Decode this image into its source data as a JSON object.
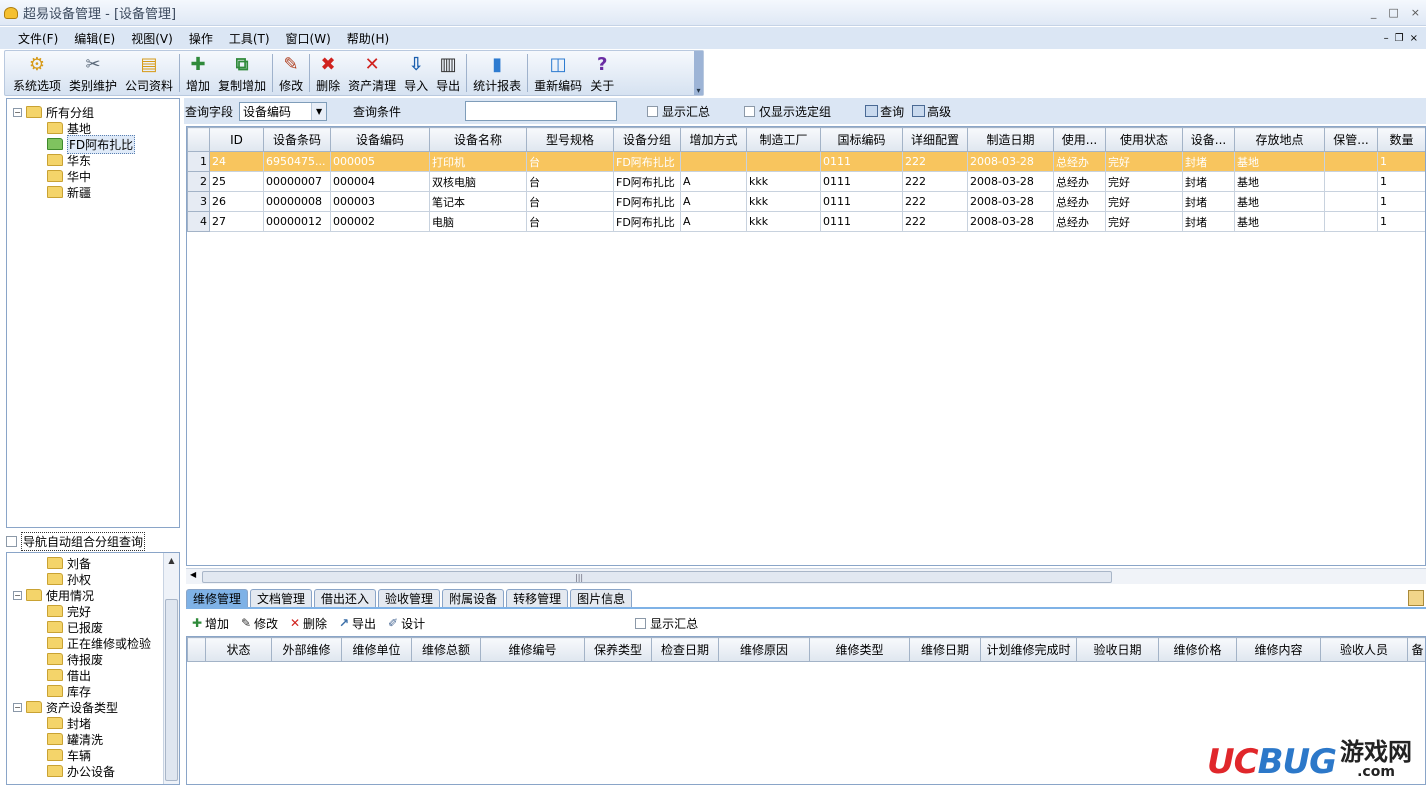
{
  "window": {
    "title": "超易设备管理 - [设备管理]",
    "minimize": "_",
    "maximize": "□",
    "close": "×"
  },
  "menu": [
    "文件(F)",
    "编辑(E)",
    "视图(V)",
    "操作",
    "工具(T)",
    "窗口(W)",
    "帮助(H)"
  ],
  "mdi_controls": {
    "min": "–",
    "restore": "❐",
    "close": "×"
  },
  "toolbar": [
    {
      "label": "系统选项",
      "icon": "system-options-icon",
      "color": "#d79b1a"
    },
    {
      "label": "类别维护",
      "icon": "tools-icon",
      "color": "#5b6a7a"
    },
    {
      "label": "公司资料",
      "icon": "company-icon",
      "color": "#d69a18"
    },
    {
      "label": "增加",
      "icon": "add-user-icon",
      "color": "#2f8a3a"
    },
    {
      "label": "复制增加",
      "icon": "copy-add-icon",
      "color": "#2f8a3a"
    },
    {
      "label": "修改",
      "icon": "pencil-icon",
      "color": "#b04020"
    },
    {
      "label": "删除",
      "icon": "delete-icon",
      "color": "#d0231f"
    },
    {
      "label": "资产清理",
      "icon": "clear-icon",
      "color": "#d0231f"
    },
    {
      "label": "导入",
      "icon": "import-icon",
      "color": "#1b5fae"
    },
    {
      "label": "导出",
      "icon": "export-icon",
      "color": "#333333"
    },
    {
      "label": "统计报表",
      "icon": "chart-icon",
      "color": "#2d7bd0"
    },
    {
      "label": "重新编码",
      "icon": "recode-icon",
      "color": "#2d7bd0"
    },
    {
      "label": "关于",
      "icon": "help-icon",
      "color": "#6a2ca3"
    }
  ],
  "tree_groups": {
    "root": "所有分组",
    "children": [
      "基地",
      "FD阿布扎比",
      "华东",
      "华中",
      "新疆"
    ],
    "selected": "FD阿布扎比"
  },
  "nav_auto_group": "导航自动组合分组查询",
  "nav_tree": [
    {
      "label": "刘备",
      "level": 1,
      "pm": ""
    },
    {
      "label": "孙权",
      "level": 1,
      "pm": ""
    },
    {
      "label": "使用情况",
      "level": 0,
      "pm": "−"
    },
    {
      "label": "完好",
      "level": 1,
      "pm": ""
    },
    {
      "label": "已报废",
      "level": 1,
      "pm": ""
    },
    {
      "label": "正在维修或检验",
      "level": 1,
      "pm": ""
    },
    {
      "label": "待报废",
      "level": 1,
      "pm": ""
    },
    {
      "label": "借出",
      "level": 1,
      "pm": ""
    },
    {
      "label": "库存",
      "level": 1,
      "pm": ""
    },
    {
      "label": "资产设备类型",
      "level": 0,
      "pm": "−"
    },
    {
      "label": "封堵",
      "level": 1,
      "pm": ""
    },
    {
      "label": "罐清洗",
      "level": 1,
      "pm": ""
    },
    {
      "label": "车辆",
      "level": 1,
      "pm": ""
    },
    {
      "label": "办公设备",
      "level": 1,
      "pm": ""
    }
  ],
  "query": {
    "field_label": "查询字段",
    "field_value": "设备编码",
    "condition_label": "查询条件",
    "condition_value": "",
    "show_summary": "显示汇总",
    "only_selected_group": "仅显示选定组",
    "search": "查询",
    "advanced": "高级"
  },
  "main_grid": {
    "columns": [
      "ID",
      "设备条码",
      "设备编码",
      "设备名称",
      "型号规格",
      "设备分组",
      "增加方式",
      "制造工厂",
      "国标编码",
      "详细配置",
      "制造日期",
      "使用...",
      "使用状态",
      "设备...",
      "存放地点",
      "保管...",
      "数量"
    ],
    "rows": [
      [
        "1",
        "24",
        "6950475...",
        "000005",
        "打印机",
        "台",
        "FD阿布扎比",
        "",
        "",
        "0111",
        "222",
        "2008-03-28",
        "总经办",
        "完好",
        "封堵",
        "基地",
        "",
        "1"
      ],
      [
        "2",
        "25",
        "00000007",
        "000004",
        "双核电脑",
        "台",
        "FD阿布扎比",
        "A",
        "kkk",
        "0111",
        "222",
        "2008-03-28",
        "总经办",
        "完好",
        "封堵",
        "基地",
        "",
        "1"
      ],
      [
        "3",
        "26",
        "00000008",
        "000003",
        "笔记本",
        "台",
        "FD阿布扎比",
        "A",
        "kkk",
        "0111",
        "222",
        "2008-03-28",
        "总经办",
        "完好",
        "封堵",
        "基地",
        "",
        "1"
      ],
      [
        "4",
        "27",
        "00000012",
        "000002",
        "电脑",
        "台",
        "FD阿布扎比",
        "A",
        "kkk",
        "0111",
        "222",
        "2008-03-28",
        "总经办",
        "完好",
        "封堵",
        "基地",
        "",
        "1"
      ]
    ],
    "selected_row": 0
  },
  "tabs": [
    "维修管理",
    "文档管理",
    "借出还入",
    "验收管理",
    "附属设备",
    "转移管理",
    "图片信息"
  ],
  "active_tab": 0,
  "sub_toolbar": {
    "add": "增加",
    "edit": "修改",
    "delete": "删除",
    "export": "导出",
    "design": "设计",
    "show_summary": "显示汇总"
  },
  "repair_grid": {
    "columns": [
      "状态",
      "外部维修",
      "维修单位",
      "维修总额",
      "维修编号",
      "保养类型",
      "检查日期",
      "维修原因",
      "维修类型",
      "维修日期",
      "计划维修完成时",
      "验收日期",
      "维修价格",
      "维修内容",
      "验收人员",
      "备"
    ]
  },
  "watermark": {
    "uc": "UC",
    "bug": "BUG",
    "cn": "游戏网",
    "com": ".com"
  }
}
